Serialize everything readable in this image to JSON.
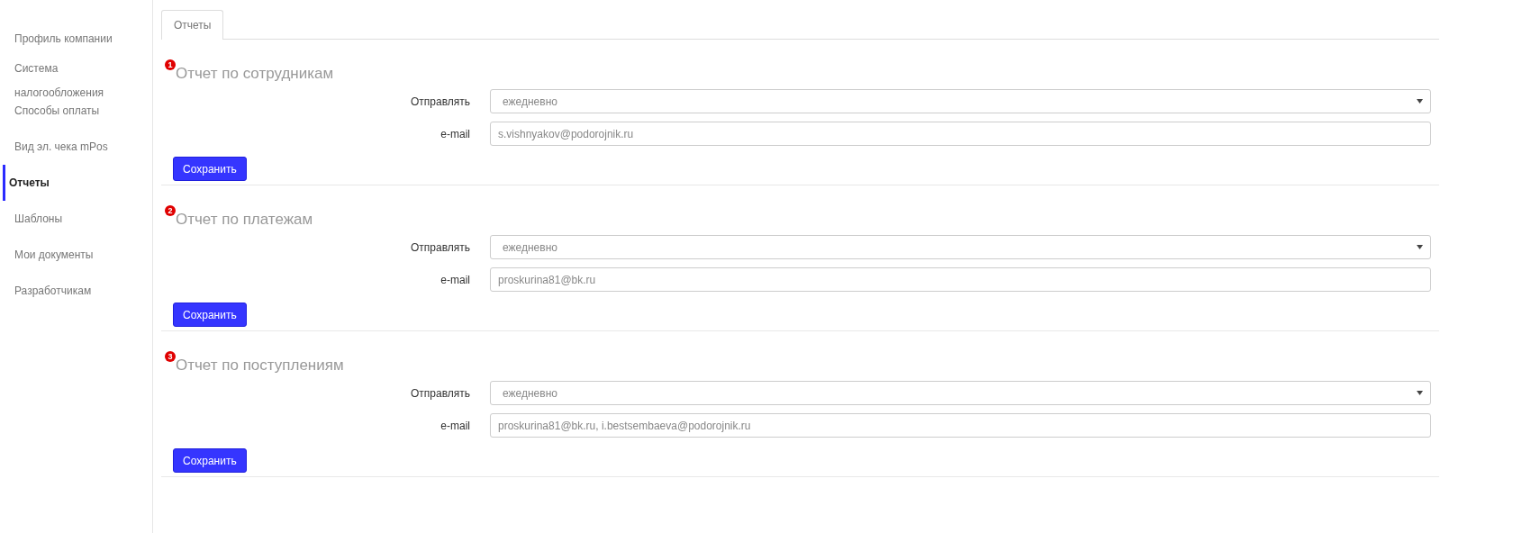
{
  "sidebar": {
    "items": [
      {
        "label": "Профиль компании",
        "selected": false
      },
      {
        "label": "Система налогообложения",
        "selected": false
      },
      {
        "label": "Способы оплаты",
        "selected": false
      },
      {
        "label": "Вид эл. чека mPos",
        "selected": false
      },
      {
        "label": "Отчеты",
        "selected": true
      },
      {
        "label": "Шаблоны",
        "selected": false
      },
      {
        "label": "Мои документы",
        "selected": false
      },
      {
        "label": "Разработчикам",
        "selected": false
      }
    ]
  },
  "tabs": [
    {
      "label": "Отчеты",
      "selected": true
    }
  ],
  "sections": [
    {
      "badge": "1",
      "title": "Отчет по сотрудникам",
      "send_label": "Отправлять",
      "send_value": "ежедневно",
      "email_label": "e-mail",
      "email_value": "s.vishnyakov@podorojnik.ru",
      "button": "Сохранить"
    },
    {
      "badge": "2",
      "title": "Отчет по платежам",
      "send_label": "Отправлять",
      "send_value": "ежедневно",
      "email_label": "e-mail",
      "email_value": "proskurina81@bk.ru",
      "button": "Сохранить"
    },
    {
      "badge": "3",
      "title": "Отчет по поступлениям",
      "send_label": "Отправлять",
      "send_value": "ежедневно",
      "email_label": "e-mail",
      "email_value": "proskurina81@bk.ru, i.bestsembaeva@podorojnik.ru",
      "button": "Сохранить"
    }
  ]
}
